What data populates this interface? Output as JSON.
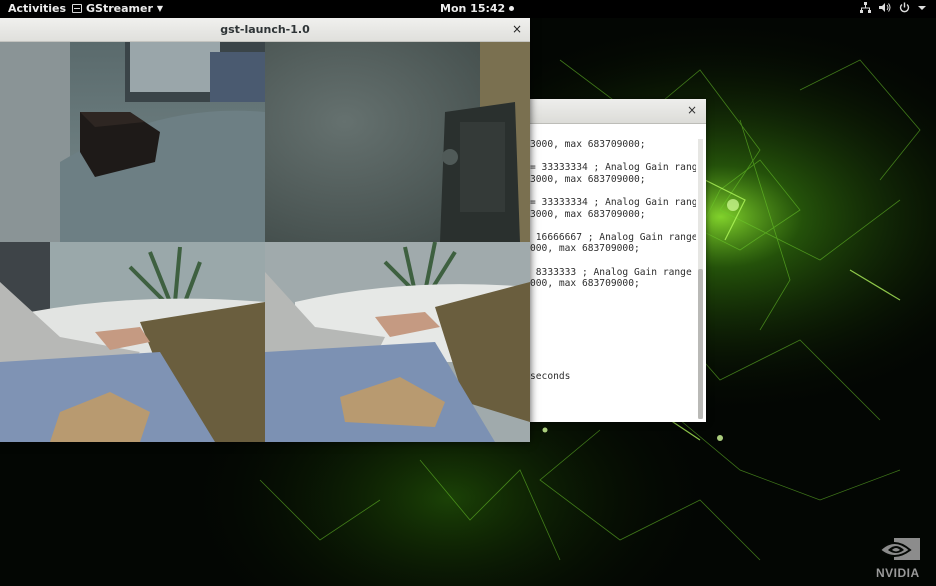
{
  "topbar": {
    "activities_label": "Activities",
    "app_menu_label": "GStreamer",
    "clock_label": "Mon 15:42",
    "icons": [
      "network-icon",
      "volume-icon",
      "power-icon",
      "chevron-down-icon"
    ]
  },
  "gst_window": {
    "title": "gst-launch-1.0",
    "close_label": "×",
    "feeds": [
      "camera-feed-1",
      "camera-feed-2",
      "camera-feed-3",
      "camera-feed-4"
    ]
  },
  "terminal_window": {
    "close_label": "×",
    "lines": [
      "3000, max 683709000;",
      "",
      "= 33333334 ; Analog Gain rang",
      "3000, max 683709000;",
      "",
      "= 33333334 ; Analog Gain rang",
      "3000, max 683709000;",
      "",
      " 16666667 ; Analog Gain range",
      "000, max 683709000;",
      "",
      " 8333333 ; Analog Gain range",
      "000, max 683709000;",
      "",
      "",
      "",
      "",
      "",
      "",
      "",
      "seconds"
    ]
  },
  "desktop": {
    "brand_label": "NVIDIA",
    "accent_color": "#76b900"
  }
}
